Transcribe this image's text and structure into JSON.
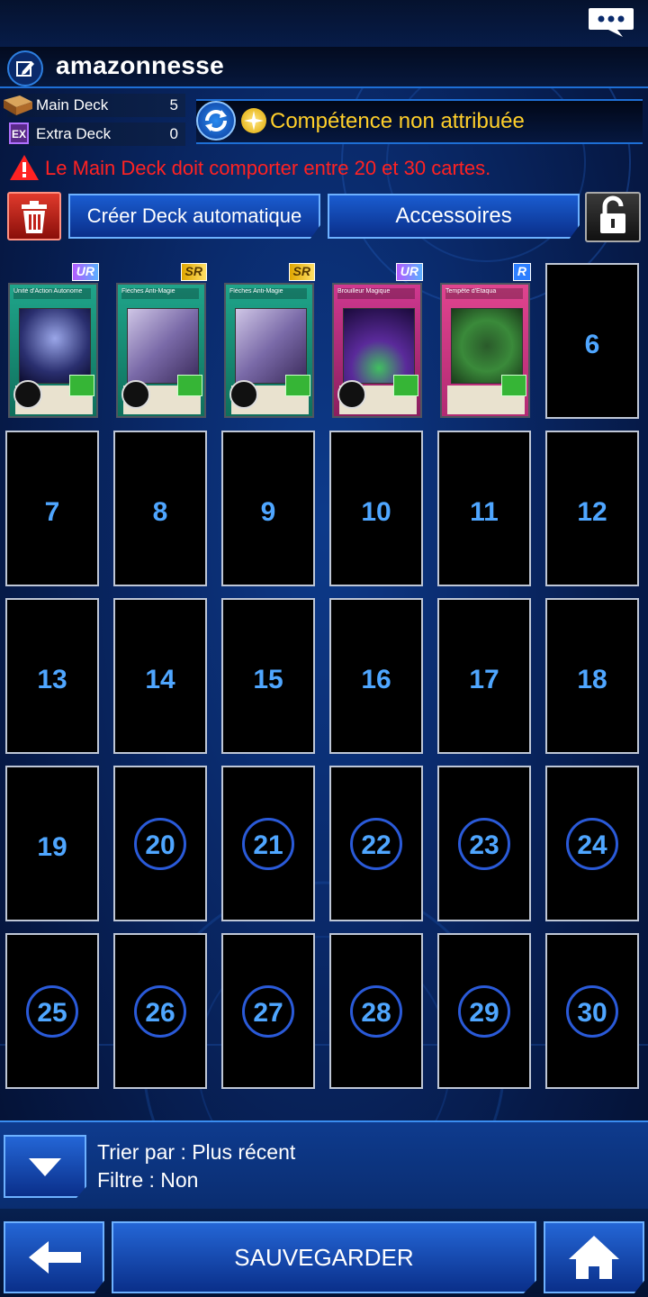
{
  "deck": {
    "name": "amazonnesse"
  },
  "counts": {
    "main_label": "Main Deck",
    "main_count": "5",
    "extra_icon": "EX",
    "extra_label": "Extra Deck",
    "extra_count": "0"
  },
  "skill": {
    "text": "Compétence non attribuée",
    "color": "#ffcf2a"
  },
  "warning": {
    "text": "Le Main Deck doit comporter entre 20 et 30 cartes.",
    "color": "#ff2222"
  },
  "actions": {
    "auto_deck": "Créer Deck automatique",
    "accessories": "Accessoires"
  },
  "cards": [
    {
      "rarity": "UR",
      "title": "Unité d'Action Autonome",
      "kind": "spell"
    },
    {
      "rarity": "SR",
      "title": "Flèches Anti-Magie",
      "kind": "spell"
    },
    {
      "rarity": "SR",
      "title": "Flèches Anti-Magie",
      "kind": "spell"
    },
    {
      "rarity": "UR",
      "title": "Brouilleur Magique",
      "kind": "trap"
    },
    {
      "rarity": "R",
      "title": "Tempête d'Etaqua",
      "kind": "trap"
    }
  ],
  "empty_slots": [
    "6",
    "7",
    "8",
    "9",
    "10",
    "11",
    "12",
    "13",
    "14",
    "15",
    "16",
    "17",
    "18",
    "19",
    "20",
    "21",
    "22",
    "23",
    "24",
    "25",
    "26",
    "27",
    "28",
    "29",
    "30"
  ],
  "sort": {
    "sort_line": "Trier par : Plus récent",
    "filter_line": "Filtre : Non"
  },
  "bottom": {
    "save": "SAUVEGARDER"
  },
  "icons": [
    "chat-icon",
    "edit-icon",
    "deck-box-icon",
    "swap-icon",
    "skill-star-icon",
    "warning-icon",
    "trash-icon",
    "lock-icon",
    "chevron-down-icon",
    "back-arrow-icon",
    "home-icon"
  ]
}
